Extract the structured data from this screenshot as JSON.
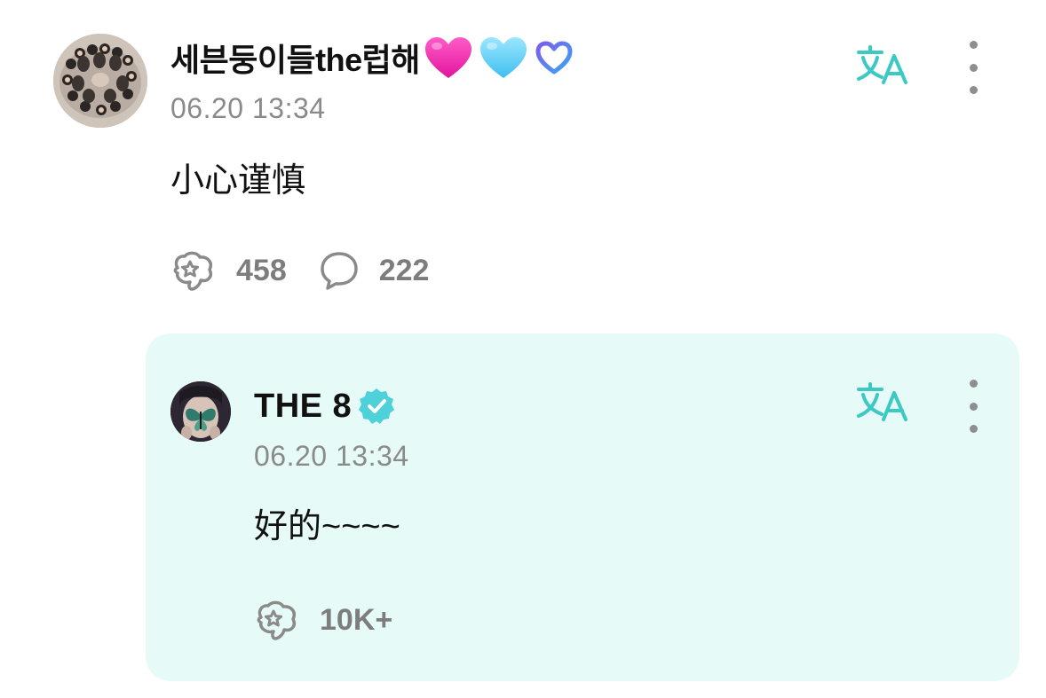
{
  "main_post": {
    "author": "세븐둥이들the럽해",
    "badges": [
      "pink-heart-emoji",
      "light-blue-heart-emoji",
      "weverse-membership-heart-icon"
    ],
    "timestamp": "06.20 13:34",
    "text": "小心谨慎",
    "like_count": "458",
    "comment_count": "222",
    "translate_icon": "translate-icon",
    "more_icon": "more-vertical-icon"
  },
  "reply": {
    "author": "THE 8",
    "verified_icon": "verified-badge-icon",
    "timestamp": "06.20 13:34",
    "text": "好的~~~~",
    "like_count": "10K+",
    "translate_icon": "translate-icon",
    "more_icon": "more-vertical-icon"
  },
  "colors": {
    "accent_teal": "#3cc9c3",
    "reply_background": "#e6fbf7",
    "muted_text": "#8a8a8a",
    "verified": "#4fd1da"
  }
}
